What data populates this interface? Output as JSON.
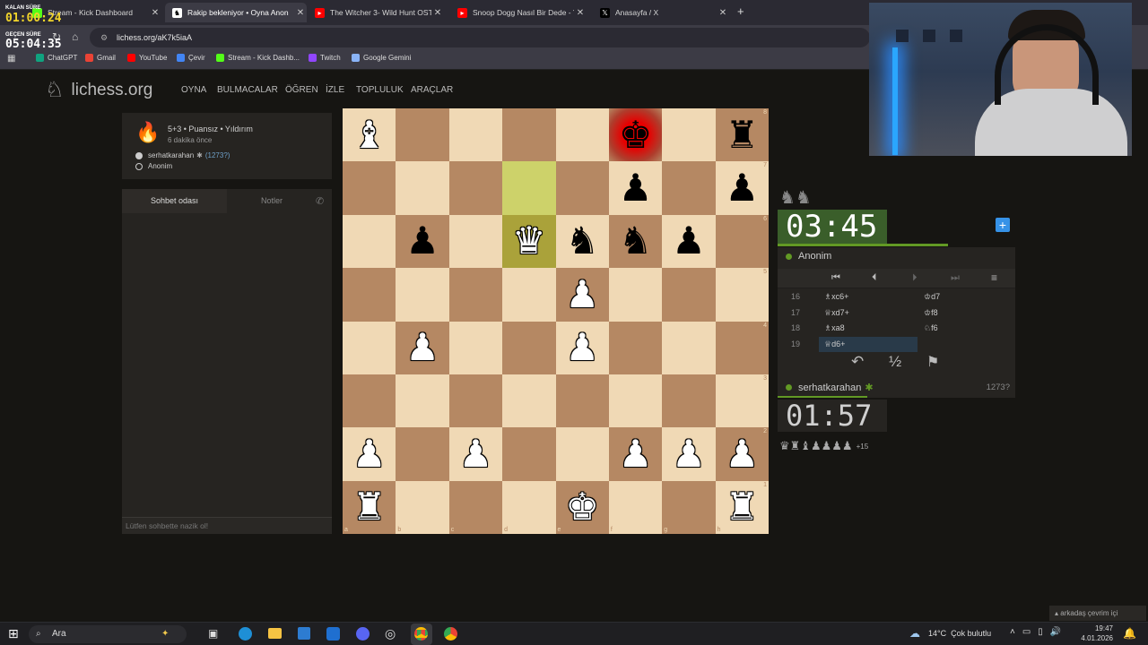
{
  "overlay": {
    "remaining_label": "KALAN SÜRE",
    "remaining_value": "01:00:24",
    "elapsed_label": "GEÇEN SÜRE",
    "elapsed_value": "05:04:35"
  },
  "tabs": [
    {
      "title": "Stream - Kick Dashboard",
      "color": "#53fc18"
    },
    {
      "title": "Rakip bekleniyor • Oyna Anon",
      "color": "#ffffff"
    },
    {
      "title": "The Witcher 3- Wild Hunt OST",
      "color": "#ff0000"
    },
    {
      "title": "Snoop Dogg Nasıl Bir Dede - Y",
      "color": "#ff0000"
    },
    {
      "title": "Anasayfa / X",
      "color": "#000000"
    }
  ],
  "address": {
    "url": "lichess.org/aK7k5iaA"
  },
  "bookmarks": [
    {
      "label": "ChatGPT",
      "icon": "chatgpt-icon",
      "color": "#10a37f"
    },
    {
      "label": "Gmail",
      "icon": "gmail-icon",
      "color": "#ea4335"
    },
    {
      "label": "YouTube",
      "icon": "youtube-icon",
      "color": "#ff0000"
    },
    {
      "label": "Çevir",
      "icon": "translate-icon",
      "color": "#4285f4"
    },
    {
      "label": "Stream - Kick Dashb...",
      "icon": "kick-icon",
      "color": "#53fc18"
    },
    {
      "label": "Twitch",
      "icon": "twitch-icon",
      "color": "#9146ff"
    },
    {
      "label": "Google Gemini",
      "icon": "gemini-icon",
      "color": "#8ab4f8"
    }
  ],
  "site": {
    "logo": "lichess.org",
    "nav": [
      "OYNA",
      "BULMACALAR",
      "ÖĞREN",
      "İZLE",
      "TOPLULUK",
      "ARAÇLAR"
    ]
  },
  "game": {
    "mode": "5+3 • Puansız • Yıldırım",
    "time_ago": "6 dakika önce",
    "white_player": "serhatkarahan",
    "white_rating": "(1273?)",
    "black_player": "Anonim"
  },
  "chat": {
    "tab_chat": "Sohbet odası",
    "tab_notes": "Notler",
    "placeholder": "Lütfen sohbette nazik ol!"
  },
  "board": {
    "pieces": [
      {
        "sq": "a8",
        "p": "♝",
        "c": "w"
      },
      {
        "sq": "f8",
        "p": "♚",
        "c": "b"
      },
      {
        "sq": "h8",
        "p": "♜",
        "c": "b"
      },
      {
        "sq": "f7",
        "p": "♟",
        "c": "b"
      },
      {
        "sq": "h7",
        "p": "♟",
        "c": "b"
      },
      {
        "sq": "b6",
        "p": "♟",
        "c": "b"
      },
      {
        "sq": "d6",
        "p": "♛",
        "c": "w"
      },
      {
        "sq": "e6",
        "p": "♞",
        "c": "b"
      },
      {
        "sq": "f6",
        "p": "♞",
        "c": "b"
      },
      {
        "sq": "g6",
        "p": "♟",
        "c": "b"
      },
      {
        "sq": "e5",
        "p": "♟",
        "c": "w"
      },
      {
        "sq": "b4",
        "p": "♟",
        "c": "w"
      },
      {
        "sq": "e4",
        "p": "♟",
        "c": "w"
      },
      {
        "sq": "a2",
        "p": "♟",
        "c": "w"
      },
      {
        "sq": "c2",
        "p": "♟",
        "c": "w"
      },
      {
        "sq": "f2",
        "p": "♟",
        "c": "w"
      },
      {
        "sq": "g2",
        "p": "♟",
        "c": "w"
      },
      {
        "sq": "h2",
        "p": "♟",
        "c": "w"
      },
      {
        "sq": "a1",
        "p": "♜",
        "c": "w"
      },
      {
        "sq": "e1",
        "p": "♚",
        "c": "w"
      },
      {
        "sq": "h1",
        "p": "♜",
        "c": "w"
      }
    ],
    "last_move": [
      "d7",
      "d6"
    ],
    "check": "f8",
    "files": [
      "a",
      "b",
      "c",
      "d",
      "e",
      "f",
      "g",
      "h"
    ],
    "ranks": [
      "8",
      "7",
      "6",
      "5",
      "4",
      "3",
      "2",
      "1"
    ]
  },
  "clocks": {
    "top": "03:45",
    "bottom": "01:57"
  },
  "players": {
    "top_name": "Anonim",
    "bottom_name": "serhatkarahan",
    "bottom_rating": "1273?"
  },
  "moves": [
    {
      "n": "16",
      "w": "♗xc6+",
      "b": "♔d7"
    },
    {
      "n": "17",
      "w": "♕xd7+",
      "b": "♔f8"
    },
    {
      "n": "18",
      "w": "♗xa8",
      "b": "♘f6"
    },
    {
      "n": "19",
      "w": "♕d6+",
      "b": ""
    }
  ],
  "actions": {
    "draw": "½"
  },
  "material": {
    "pieces": "♛♜♝♟♟♟♟",
    "diff": "+15"
  },
  "friends": "arkadaş çevrim içi",
  "taskbar": {
    "search": "Ara",
    "weather": "14°C  Çok bulutlu",
    "time": "19:47",
    "date": "4.01.2026"
  }
}
